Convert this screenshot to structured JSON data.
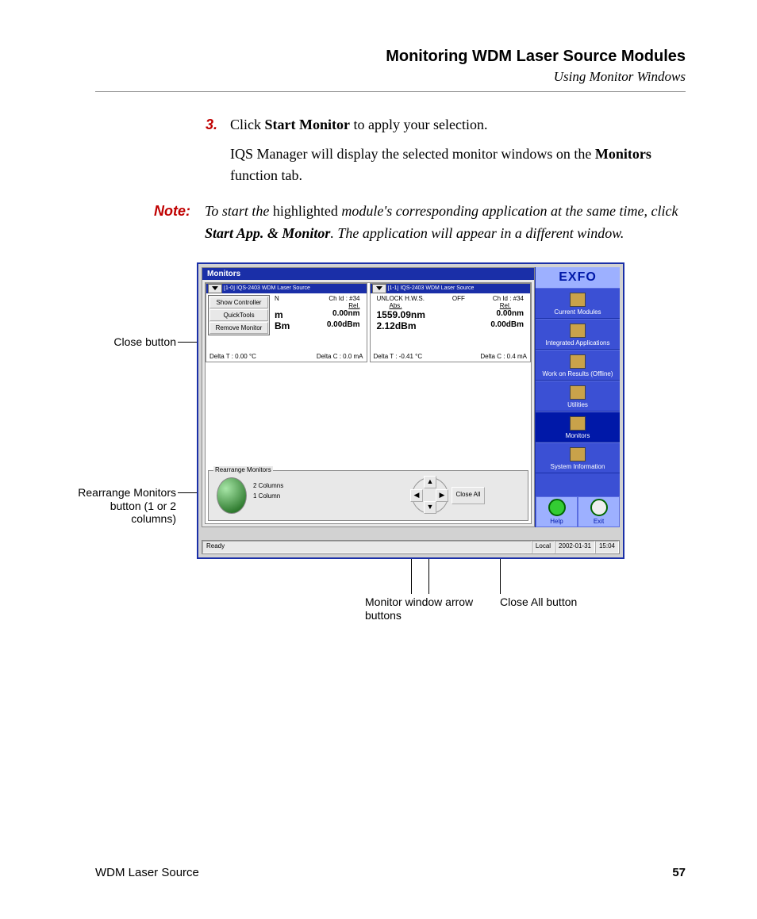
{
  "header": {
    "title": "Monitoring WDM Laser Source Modules",
    "subtitle": "Using Monitor Windows"
  },
  "step": {
    "num": "3.",
    "l1a": "Click ",
    "l1b": "Start Monitor",
    "l1c": " to apply your selection.",
    "l2a": "IQS Manager will display the selected monitor windows on the ",
    "l2b": "Monitors",
    "l2c": " function tab."
  },
  "note": {
    "label": "Note:",
    "a": "To start the ",
    "b": "highlighted",
    "c": " module's corresponding application at the same time, click ",
    "d": "Start App. & Monitor",
    "e": ". The application will appear in a different window."
  },
  "callouts": {
    "close": "Close button",
    "rearrange": "Rearrange Monitors button (1 or 2 columns)",
    "arrows": "Monitor window arrow buttons",
    "closeall": "Close All button"
  },
  "app": {
    "monitors_title": "Monitors",
    "card1": {
      "title": "[1-0] IQS-2403 WDM Laser Source",
      "ch": "Ch Id : #34",
      "menu": [
        "Show Controller",
        "QuickTools",
        "Remove Monitor"
      ],
      "rel_lbl": "Rel.",
      "nm": "0.00nm",
      "dbm": "0.00dBm",
      "m_suffix": "m",
      "bm_suffix": "Bm",
      "dt": "Delta T :  0.00 °C",
      "dc": "Delta C :   0.0 mA"
    },
    "card2": {
      "title": "[1-1] IQS-2403 WDM Laser Source",
      "unlock": "UNLOCK H.W.S.",
      "off": "OFF",
      "ch": "Ch Id : #34",
      "abs_lbl": "Abs.",
      "rel_lbl": "Rel.",
      "abs_nm": "1559.09nm",
      "rel_nm": "0.00nm",
      "abs_dbm": "2.12dBm",
      "rel_dbm": "0.00dBm",
      "dt": "Delta T : -0.41 °C",
      "dc": "Delta C :   0.4 mA"
    },
    "rearrange": {
      "legend": "Rearrange Monitors",
      "c2": "2 Columns",
      "c1": "1 Column"
    },
    "close_all": "Close All",
    "sidebar": {
      "logo": "EXFO",
      "items": [
        "Current Modules",
        "Integrated Applications",
        "Work on Results (Offline)",
        "Utilities",
        "Monitors",
        "System Information"
      ],
      "help": "Help",
      "exit": "Exit"
    },
    "status": {
      "ready": "Ready",
      "local": "Local",
      "date": "2002-01-31",
      "time": "15:04"
    }
  },
  "footer": {
    "left": "WDM Laser Source",
    "page": "57"
  }
}
